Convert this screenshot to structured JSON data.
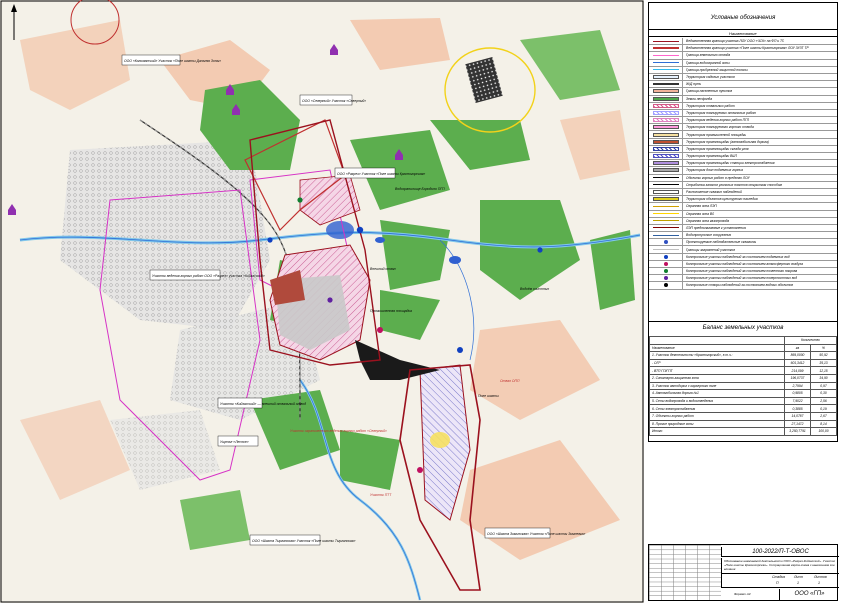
{
  "legend": {
    "title": "Условные обозначения",
    "head_left": "",
    "head_right": "Наименование",
    "items": [
      {
        "label": "Ведомственная граница участка ЛОУ ООО «ЧСК» на ФП и ТП",
        "symbol": "line",
        "color": "#9b111e"
      },
      {
        "label": "Ведомственная граница участка «Поле шахты Красногорская» ЛОУ ЗУЗТ ТР",
        "symbol": "line-thick",
        "color": "#c0302f"
      },
      {
        "label": "Граница земельного отвода",
        "symbol": "line",
        "color": "#ff66cc"
      },
      {
        "label": "Граница водоохранной зоны",
        "symbol": "line",
        "color": "#2f6fd6"
      },
      {
        "label": "Граница прибрежной защитной полосы",
        "symbol": "line",
        "color": "#33bbee"
      },
      {
        "label": "Территория садовых участков",
        "symbol": "box",
        "color": "#e6f2ff"
      },
      {
        "label": "Ж/Д пути",
        "symbol": "rail",
        "color": "#333333"
      },
      {
        "label": "Граница населенных пунктов",
        "symbol": "box",
        "color": "#f2b29a"
      },
      {
        "label": "Земли лесфонда",
        "symbol": "box",
        "color": "#4fa84b"
      },
      {
        "label": "Территория отвальных работ",
        "symbol": "hatch",
        "color": "#d45a8a"
      },
      {
        "label": "Территория планируемых отвальных работ",
        "symbol": "hatch",
        "color": "#a0a0ff"
      },
      {
        "label": "Территория ведения горных работ ПГП",
        "symbol": "hatch",
        "color": "#e080c0"
      },
      {
        "label": "Территория планируемого горного отвода",
        "symbol": "box",
        "color": "#ff99dd"
      },
      {
        "label": "Территория промышленной площадки",
        "symbol": "box",
        "color": "#f6e0a0"
      },
      {
        "label": "Территория промплощадки (автомобильная дорога)",
        "symbol": "box",
        "color": "#c05030"
      },
      {
        "label": "Территория промплощадки склада угля",
        "symbol": "hatch",
        "color": "#3040a0"
      },
      {
        "label": "Территория промплощадки ВШТ",
        "symbol": "hatch",
        "color": "#5050c0"
      },
      {
        "label": "Территория промплощадки станции электроснабжения",
        "symbol": "box",
        "color": "#b090e0"
      },
      {
        "label": "Территория длин подземных горных",
        "symbol": "box",
        "color": "#a9a9a9"
      },
      {
        "label": "Объекты горных работ в пределах ЛОУ",
        "symbol": "line",
        "color": "#000000"
      },
      {
        "label": "Отработка запасов угольных пластов открытым способом",
        "symbol": "line",
        "color": "#000000"
      },
      {
        "label": "Расположение скважин наблюдений",
        "symbol": "box",
        "color": "#ffffff"
      },
      {
        "label": "Территория объектов культурного наследия",
        "symbol": "box",
        "color": "#e0d020"
      },
      {
        "label": "Охранная зона ЛЭП",
        "symbol": "line",
        "color": "#d0a000"
      },
      {
        "label": "Охранная зона ВЛ",
        "symbol": "line",
        "color": "#ffd400"
      },
      {
        "label": "Охранная зона газопровода",
        "symbol": "line",
        "color": "#c0a000"
      },
      {
        "label": "ЛЭП предполагаемые к установлению",
        "symbol": "line",
        "color": "#800000"
      },
      {
        "label": "Водопропускные сооружения",
        "symbol": "line",
        "color": "#3060a0"
      },
      {
        "label": "Проектируемые наблюдательные скважины",
        "symbol": "dot",
        "color": "#3050c0"
      },
      {
        "label": "Границы загрязнений участков",
        "symbol": "line",
        "color": "#c0c0c0"
      },
      {
        "label": "Контрольные участки наблюдений за состоянием подземных вод",
        "symbol": "dot",
        "color": "#1040c0"
      },
      {
        "label": "Контрольные участки наблюдений за состоянием атмосферного воздуха",
        "symbol": "dot",
        "color": "#c01060"
      },
      {
        "label": "Контрольные участки наблюдений за состоянием почвенного покрова",
        "symbol": "dot",
        "color": "#108030"
      },
      {
        "label": "Контрольные участки наблюдений за состоянием поверхностных вод",
        "symbol": "dot",
        "color": "#6020a0"
      },
      {
        "label": "Контрольные створы наблюдений за состоянием водных объектов",
        "symbol": "dot",
        "color": "#000000"
      }
    ]
  },
  "balance": {
    "title": "Баланс земельных участков",
    "header": [
      "Наименование",
      "Количество",
      "га",
      "%"
    ],
    "rows": [
      [
        "1. Участок деятельности «Красногорский», в т.ч.:",
        "869,0000",
        "50,92"
      ],
      [
        "- ОГР",
        "601,3412",
        "35,13"
      ],
      [
        "- ВТП ГП/ГПТ",
        "214,099",
        "12,15"
      ],
      [
        "2. Санитарно-защитная зона",
        "196,0737",
        "34,90"
      ],
      [
        "3. Участок автодорог с карьерного поле",
        "2,7994",
        "0,97"
      ],
      [
        "4. Автомобильная дорога №1",
        "0,9805",
        "0,30"
      ],
      [
        "5. Сети водопровода и водоотведения",
        "7,9022",
        "2,56"
      ],
      [
        "6. Сети электроснабжения",
        "0,3885",
        "0,19"
      ],
      [
        "7. Объекты горных работ",
        "14,0787",
        "2,67"
      ],
      [
        "8. Прочие природные зоны",
        "27,1472",
        "8,14"
      ],
      [
        "Итого",
        "3,250,7791",
        "100,00"
      ]
    ]
  },
  "stamp": {
    "code": "100-2022/П-Т-ОВОС",
    "description": "Обоснование намечаемой деятельности ООО «Разрез Кийзасский». Участок «Поле шахты Красногорская». Ситуационная карта-схема с нанесением зон влияния",
    "stage_label": "Стадия",
    "sheet_label": "Лист",
    "sheets_label": "Листов",
    "stage": "П",
    "sheet": "1",
    "sheets": "1",
    "company": "ООО «ГП»",
    "format_note": "Формат А3"
  },
  "map_labels": [
    {
      "key": "ooo_kolyvan",
      "text": "ООО «Колыванский» Участок «Поле шахты Дальняя Зоны»"
    },
    {
      "key": "ooo_severny",
      "text": "ООО «Северный» Участок «Северный»"
    },
    {
      "key": "ooo_krasnogorsk",
      "text": "ООО «Разрез» Участок «Поле шахты Красногорская»"
    },
    {
      "key": "vodohran",
      "text": "Водохранилище Бородино ПГП"
    },
    {
      "key": "otval_east",
      "text": "Внешний отвал"
    },
    {
      "key": "ploshadka",
      "text": "Промышленная площадка"
    },
    {
      "key": "nasyp",
      "text": "Поле шахты"
    },
    {
      "key": "raz_kiy",
      "text": "Участок ведения горных работ ООО «Разрез» участка «Кийзасский»"
    },
    {
      "key": "ooo_tyrganskaya",
      "text": "ООО «Шахта Тырганская» Участок «Поле шахты Тырганская»"
    },
    {
      "key": "ooo_zimneva",
      "text": "ООО «Шахта Зиминская» Участок «Поле шахты Зимневка»"
    },
    {
      "key": "otvod_south",
      "text": "Участок ограниченного ведения горных работ «Северный»"
    },
    {
      "key": "zasyp",
      "text": "Отвал ОПП"
    },
    {
      "key": "rakeny",
      "text": "Участок ПТТ"
    },
    {
      "key": "marker_pink",
      "text": "Участок «Кийзасский» — внешний отвальный отвод"
    },
    {
      "key": "leso",
      "text": "Ущелье «Лесное»"
    },
    {
      "key": "vodoem",
      "text": "Водоём очистных"
    }
  ]
}
